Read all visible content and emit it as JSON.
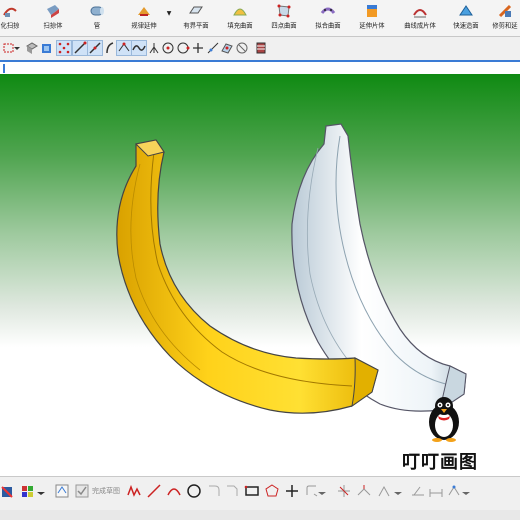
{
  "ribbon": {
    "items": [
      {
        "label": "化扫掠",
        "icon": "variational-sweep-icon"
      },
      {
        "label": "扫掠体",
        "icon": "sweep-body-icon"
      },
      {
        "label": "管",
        "icon": "tube-icon"
      },
      {
        "label": "规律延伸",
        "icon": "law-extension-icon"
      },
      {
        "label": "有界平面",
        "icon": "bounded-plane-icon"
      },
      {
        "label": "填充曲面",
        "icon": "fill-surface-icon"
      },
      {
        "label": "四点曲面",
        "icon": "four-point-surface-icon"
      },
      {
        "label": "拟合曲面",
        "icon": "fit-surface-icon"
      },
      {
        "label": "延伸片体",
        "icon": "extend-sheet-icon"
      },
      {
        "label": "曲线成片体",
        "icon": "curve-to-sheet-icon"
      },
      {
        "label": "快速造面",
        "icon": "quick-surface-icon"
      },
      {
        "label": "修剪和延",
        "icon": "trim-extend-icon"
      }
    ]
  },
  "bottom_toolbar": {
    "sketch_label": "完成草图"
  },
  "watermark": {
    "text": "叮叮画图"
  },
  "colors": {
    "viewport_top": "#0f8a12",
    "viewport_bottom": "#ffffff",
    "yellow_banana": "#f5c400",
    "white_banana": "#e4eef4"
  }
}
